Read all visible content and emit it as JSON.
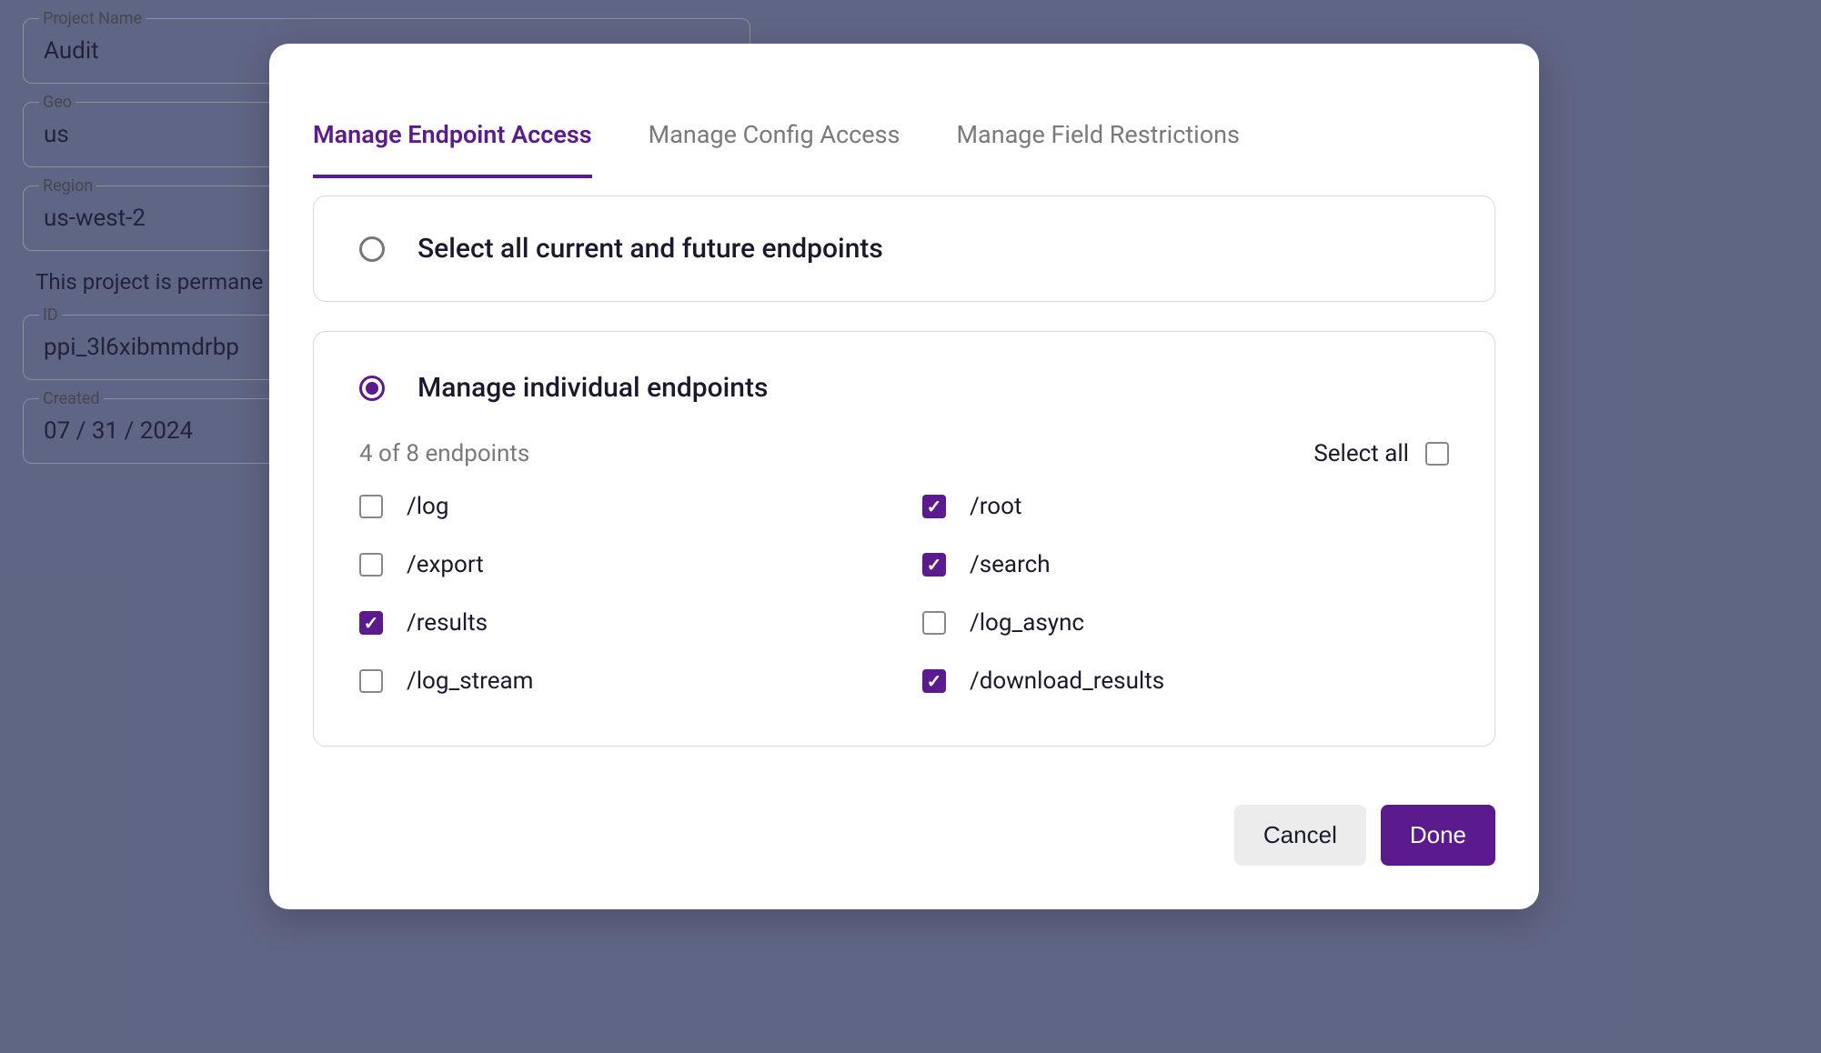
{
  "background": {
    "fields": [
      {
        "label": "Project Name",
        "value": "Audit"
      },
      {
        "label": "Geo",
        "value": "us"
      },
      {
        "label": "Region",
        "value": "us-west-2"
      }
    ],
    "permanent_text": "This project is permane",
    "fields2": [
      {
        "label": "ID",
        "value": "ppi_3l6xibmmdrbp"
      },
      {
        "label": "Created",
        "value": "07 / 31 / 2024"
      }
    ]
  },
  "modal": {
    "tabs": [
      {
        "label": "Manage Endpoint Access",
        "active": true
      },
      {
        "label": "Manage Config Access",
        "active": false
      },
      {
        "label": "Manage Field Restrictions",
        "active": false
      }
    ],
    "option_all": {
      "label": "Select all current and future endpoints",
      "selected": false
    },
    "option_individual": {
      "label": "Manage individual endpoints",
      "selected": true,
      "count_text": "4 of 8 endpoints",
      "select_all_label": "Select all",
      "select_all_checked": false,
      "endpoints_col1": [
        {
          "label": "/log",
          "checked": false
        },
        {
          "label": "/export",
          "checked": false
        },
        {
          "label": "/results",
          "checked": true
        },
        {
          "label": "/log_stream",
          "checked": false
        }
      ],
      "endpoints_col2": [
        {
          "label": "/root",
          "checked": true
        },
        {
          "label": "/search",
          "checked": true
        },
        {
          "label": "/log_async",
          "checked": false
        },
        {
          "label": "/download_results",
          "checked": true
        }
      ]
    },
    "actions": {
      "cancel": "Cancel",
      "done": "Done"
    }
  }
}
